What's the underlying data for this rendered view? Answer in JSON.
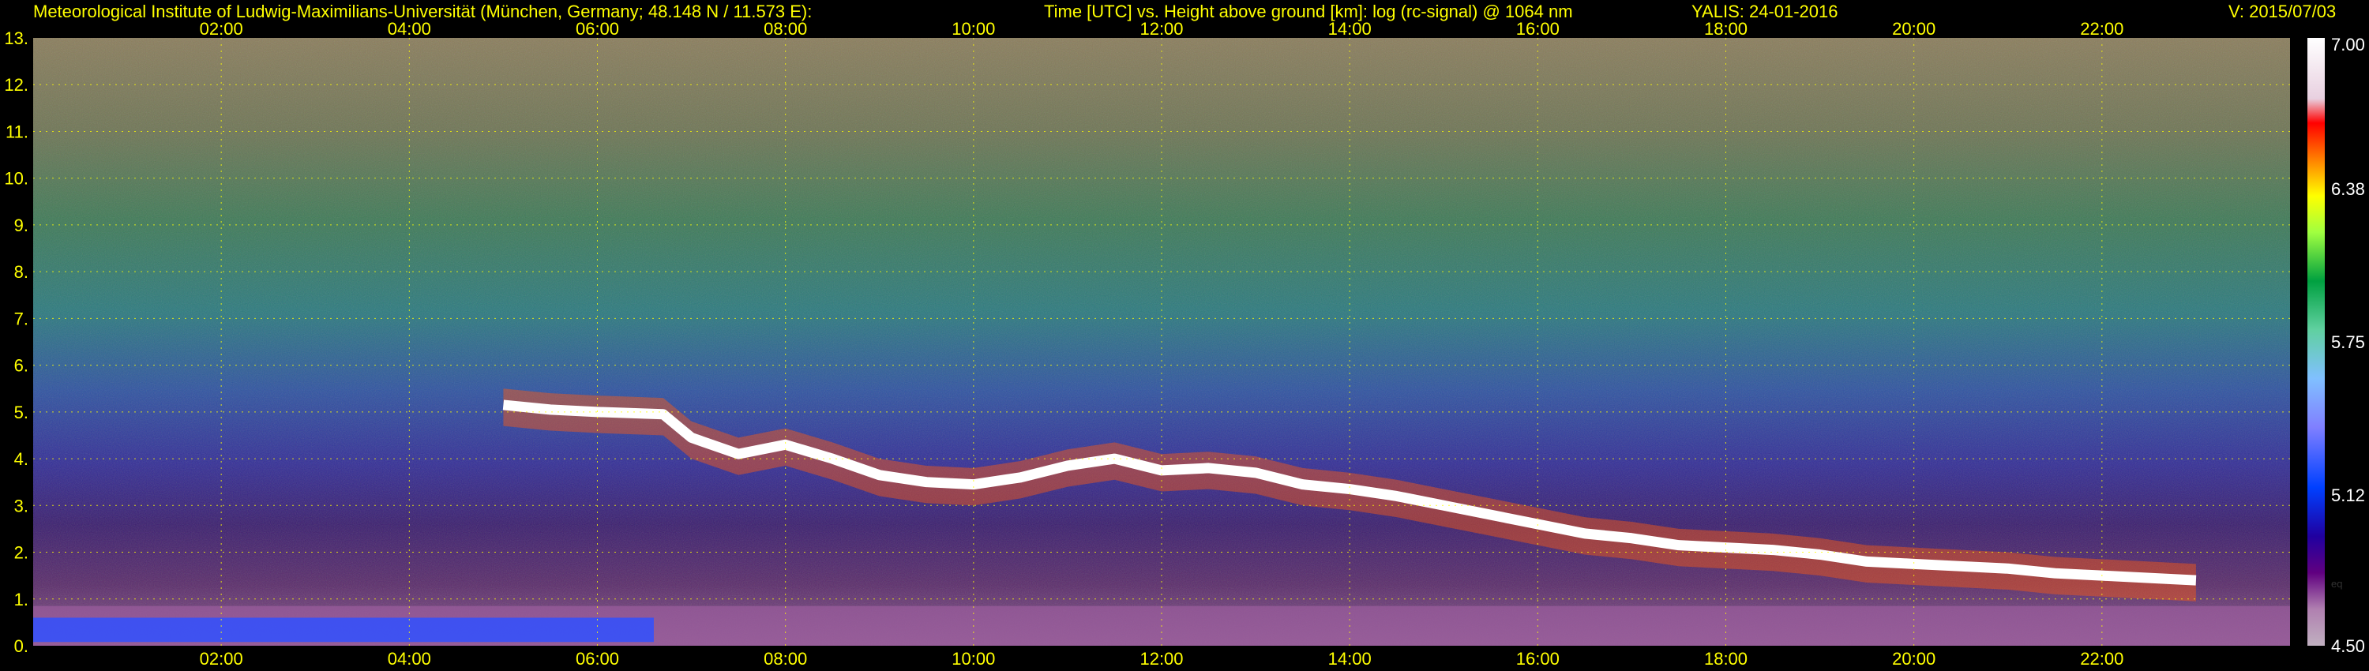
{
  "header": {
    "institute": "Meteorological Institute of Ludwig-Maximilians-Universität (München, Germany; 48.148 N / 11.573 E):",
    "description": "Time [UTC] vs. Height above ground [km]: log (rc-signal) @ 1064 nm",
    "instrument_date": "YALIS: 24-01-2016",
    "version": "V: 2015/07/03"
  },
  "chart_data": {
    "type": "heatmap",
    "title": "Time [UTC] vs. Height above ground [km]: log (rc-signal) @ 1064 nm",
    "x_ticks": [
      "02:00",
      "04:00",
      "06:00",
      "08:00",
      "10:00",
      "12:00",
      "14:00",
      "16:00",
      "18:00",
      "20:00",
      "22:00"
    ],
    "x_tick_hours": [
      2,
      4,
      6,
      8,
      10,
      12,
      14,
      16,
      18,
      20,
      22
    ],
    "xlim": [
      0,
      24
    ],
    "y_ticks": [
      "0.",
      "1.",
      "2.",
      "3.",
      "4.",
      "5.",
      "6.",
      "7.",
      "8.",
      "9.",
      "10.",
      "11.",
      "12.",
      "13."
    ],
    "ylim": [
      0,
      13
    ],
    "grid": true,
    "colorbar": {
      "ticks": [
        "7.00",
        "6.38",
        "5.75",
        "5.12",
        "4.50"
      ],
      "tick_values": [
        7.0,
        6.38,
        5.75,
        5.12,
        4.5
      ],
      "range": [
        4.5,
        7.0
      ],
      "note": "eq"
    },
    "cloud_layer_km": [
      {
        "t": 5.0,
        "h": 5.15
      },
      {
        "t": 5.5,
        "h": 5.05
      },
      {
        "t": 6.0,
        "h": 5.0
      },
      {
        "t": 6.7,
        "h": 4.95
      },
      {
        "t": 7.0,
        "h": 4.45
      },
      {
        "t": 7.5,
        "h": 4.1
      },
      {
        "t": 8.0,
        "h": 4.3
      },
      {
        "t": 8.5,
        "h": 4.0
      },
      {
        "t": 9.0,
        "h": 3.65
      },
      {
        "t": 9.5,
        "h": 3.5
      },
      {
        "t": 10.0,
        "h": 3.45
      },
      {
        "t": 10.5,
        "h": 3.6
      },
      {
        "t": 11.0,
        "h": 3.85
      },
      {
        "t": 11.5,
        "h": 4.0
      },
      {
        "t": 12.0,
        "h": 3.75
      },
      {
        "t": 12.5,
        "h": 3.8
      },
      {
        "t": 13.0,
        "h": 3.7
      },
      {
        "t": 13.5,
        "h": 3.45
      },
      {
        "t": 14.0,
        "h": 3.35
      },
      {
        "t": 14.5,
        "h": 3.2
      },
      {
        "t": 15.0,
        "h": 3.0
      },
      {
        "t": 15.5,
        "h": 2.8
      },
      {
        "t": 16.0,
        "h": 2.6
      },
      {
        "t": 16.5,
        "h": 2.4
      },
      {
        "t": 17.0,
        "h": 2.3
      },
      {
        "t": 17.5,
        "h": 2.15
      },
      {
        "t": 18.0,
        "h": 2.1
      },
      {
        "t": 18.5,
        "h": 2.05
      },
      {
        "t": 19.0,
        "h": 1.95
      },
      {
        "t": 19.5,
        "h": 1.8
      },
      {
        "t": 20.0,
        "h": 1.75
      },
      {
        "t": 20.5,
        "h": 1.7
      },
      {
        "t": 21.0,
        "h": 1.65
      },
      {
        "t": 21.5,
        "h": 1.55
      },
      {
        "t": 22.0,
        "h": 1.5
      },
      {
        "t": 22.5,
        "h": 1.45
      },
      {
        "t": 23.0,
        "h": 1.4
      }
    ],
    "boundary_layer_top_km": 0.85
  }
}
